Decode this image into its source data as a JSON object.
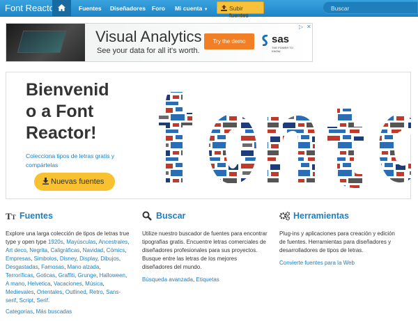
{
  "nav": {
    "brand": "Font Reactor",
    "links": [
      "Fuentes",
      "Diseñadores",
      "Foro",
      "Mi cuenta"
    ],
    "upload_label": "Subir fuentes",
    "search_placeholder": "Buscar"
  },
  "ad": {
    "title": "Visual Analytics",
    "subtitle": "See your data for all it's worth.",
    "cta": "Try the demo",
    "logo": "sas",
    "logo_tagline": "THE POWER TO KNOW."
  },
  "hero": {
    "title_lines": [
      "Bienvenid",
      "o a Font",
      "Reactor!"
    ],
    "subtitle": "Colecciona tipos de letras gratis y compártelas",
    "button": "Nuevas fuentes"
  },
  "columns": [
    {
      "title": "Fuentes",
      "intro": "Explore una larga colección de tipos de letras true type y open type",
      "links": [
        "1920s",
        "Mayúsculas",
        "Ancestrales",
        "Art deco",
        "Negrita",
        "Caligráficas",
        "Navidad",
        "Cómics",
        "Empresas",
        "Simbolos",
        "Disney",
        "Display",
        "Dibujos",
        "Desgastadas",
        "Famosas",
        "Mano alzada",
        "Terroríficas",
        "Goticas",
        "Graffiti",
        "Grunge",
        "Halloween",
        "A mano",
        "Helvetica",
        "Vacaciones",
        "Música",
        "Medievales",
        "Orientales",
        "Outlined",
        "Retro",
        "Sans-serif",
        "Script",
        "Serif"
      ],
      "footer_links": [
        "Categorías",
        "Más buscadas"
      ]
    },
    {
      "title": "Buscar",
      "intro": "Utilize nuestro buscador de fuentes para encontrar tipografías gratis. Encuentre letras comerciales de diseñadores profesionales para sus proyectos. Busque entre las letras de los mejores diseñadores del mundo.",
      "links": [
        "Búsqueda avanzada",
        "Etiquetas"
      ]
    },
    {
      "title": "Herramientas",
      "intro": "Plug-ins y aplicaciones para creación y edición de fuentes. Herramientas para diseñadores y desarrolladores de tipos de letras.",
      "links": [
        "Convierte fuentes para la Web"
      ]
    }
  ],
  "colors": {
    "accent": "#1d7fc0",
    "nav": "#2594d6",
    "button": "#f7c12f"
  }
}
